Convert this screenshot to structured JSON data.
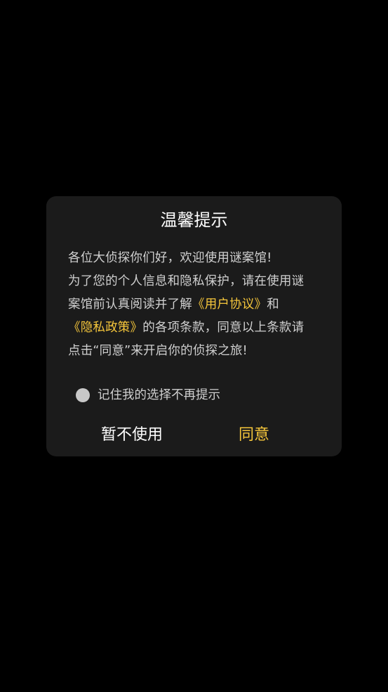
{
  "dialog": {
    "title": "温馨提示",
    "greeting": "各位大侦探你们好，欢迎使用谜案馆!",
    "line2": "为了您的个人信息和隐私保护，请在使用谜",
    "line3_prefix": "案馆前认真阅读并了解",
    "user_agreement_link": "《用户协议》",
    "line3_suffix": "和",
    "privacy_policy_link": "《隐私政策》",
    "line4_suffix": "的各项条款，同意以上条款请",
    "line5": "点击“同意”来开启你的侦探之旅!",
    "remember_label": "记住我的选择不再提示",
    "cancel_label": "暂不使用",
    "agree_label": "同意"
  },
  "colors": {
    "background": "#000000",
    "dialog_background": "#1b1b1b",
    "accent": "#f5c63b",
    "text": "#d0d0d0"
  }
}
